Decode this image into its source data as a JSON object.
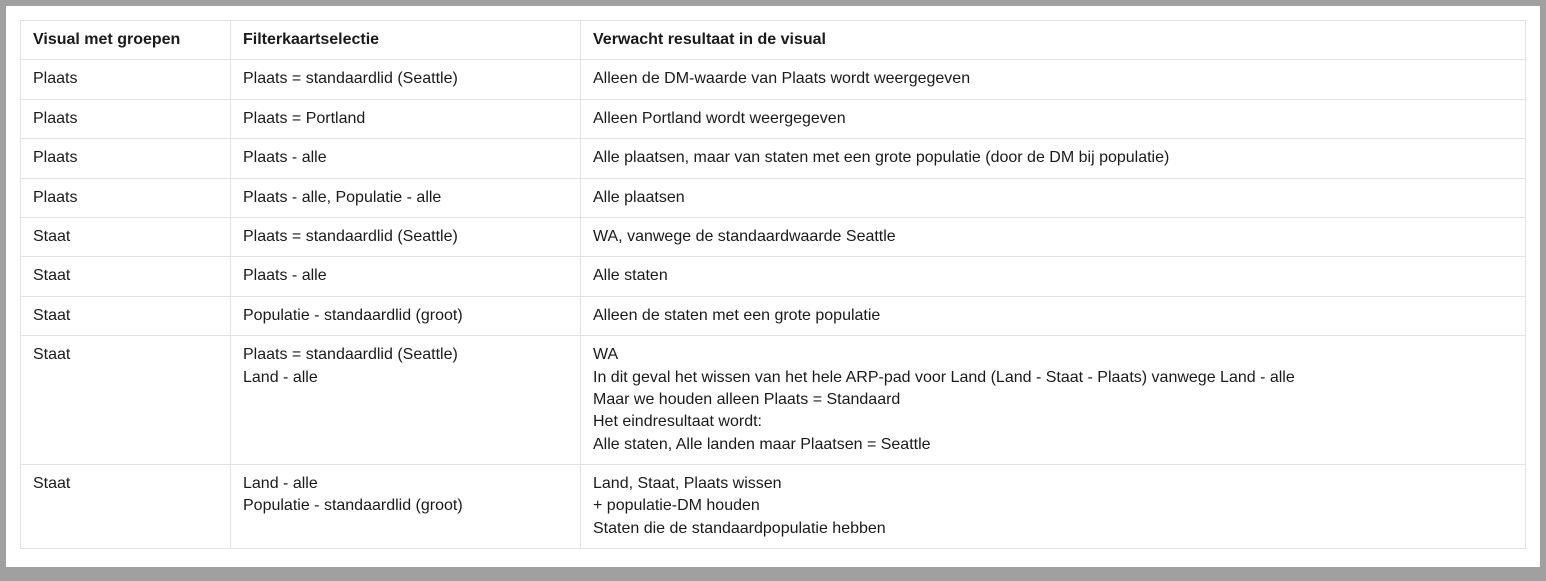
{
  "table": {
    "headers": {
      "col1": "Visual met groepen",
      "col2": "Filterkaartselectie",
      "col3": "Verwacht resultaat in de visual"
    },
    "rows": [
      {
        "col1": "Plaats",
        "col2": "Plaats = standaardlid (Seattle)",
        "col3": "Alleen de DM-waarde van Plaats wordt weergegeven"
      },
      {
        "col1": "Plaats",
        "col2": "Plaats = Portland",
        "col3": "Alleen Portland wordt weergegeven"
      },
      {
        "col1": "Plaats",
        "col2": "Plaats - alle",
        "col3": "Alle plaatsen, maar van staten met een grote populatie (door de DM bij populatie)"
      },
      {
        "col1": "Plaats",
        "col2": "Plaats - alle, Populatie - alle",
        "col3": "Alle plaatsen"
      },
      {
        "col1": "Staat",
        "col2": "Plaats = standaardlid (Seattle)",
        "col3": "WA, vanwege de standaardwaarde Seattle"
      },
      {
        "col1": "Staat",
        "col2": "Plaats - alle",
        "col3": "Alle staten"
      },
      {
        "col1": "Staat",
        "col2": "Populatie - standaardlid (groot)",
        "col3": "Alleen de staten met een grote populatie"
      },
      {
        "col1": "Staat",
        "col2": "Plaats = standaardlid (Seattle)\nLand - alle",
        "col3": "WA\nIn dit geval het wissen van het hele ARP-pad voor Land (Land - Staat - Plaats) vanwege Land - alle\nMaar we houden alleen Plaats = Standaard\nHet eindresultaat wordt:\nAlle staten, Alle landen maar Plaatsen = Seattle"
      },
      {
        "col1": "Staat",
        "col2": "Land - alle\nPopulatie - standaardlid (groot)",
        "col3": "Land, Staat, Plaats wissen\n+ populatie-DM houden\nStaten die de standaardpopulatie hebben"
      }
    ]
  }
}
